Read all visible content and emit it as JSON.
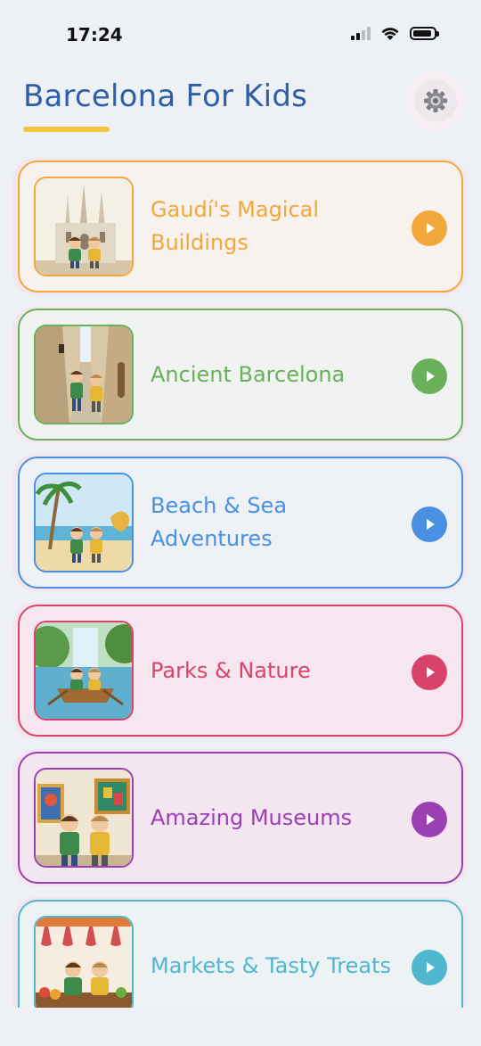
{
  "status_bar": {
    "time": "17:24"
  },
  "header": {
    "title": "Barcelona For Kids",
    "settings_icon": "gear-icon"
  },
  "colors": {
    "title": "#2f5ea8",
    "underline": "#f5c542"
  },
  "categories": [
    {
      "label": "Gaudí's Magical Buildings",
      "color": "#f2a73b",
      "bg": "#f7f2ee",
      "image": "sagrada-familia-kids"
    },
    {
      "label": "Ancient Barcelona",
      "color": "#6ab05a",
      "bg": "#f0f3f2",
      "image": "gothic-quarter-kids"
    },
    {
      "label": "Beach & Sea Adventures",
      "color": "#4a90e2",
      "bg": "#eef2f7",
      "image": "beach-kids"
    },
    {
      "label": "Parks & Nature",
      "color": "#d9436b",
      "bg": "#f5e6ef",
      "image": "park-boat-kids"
    },
    {
      "label": "Amazing Museums",
      "color": "#9b3fb5",
      "bg": "#f4e6f0",
      "image": "museum-kids"
    },
    {
      "label": "Markets & Tasty Treats",
      "color": "#4fb7cf",
      "bg": "#edf2f5",
      "image": "market-kids"
    }
  ]
}
